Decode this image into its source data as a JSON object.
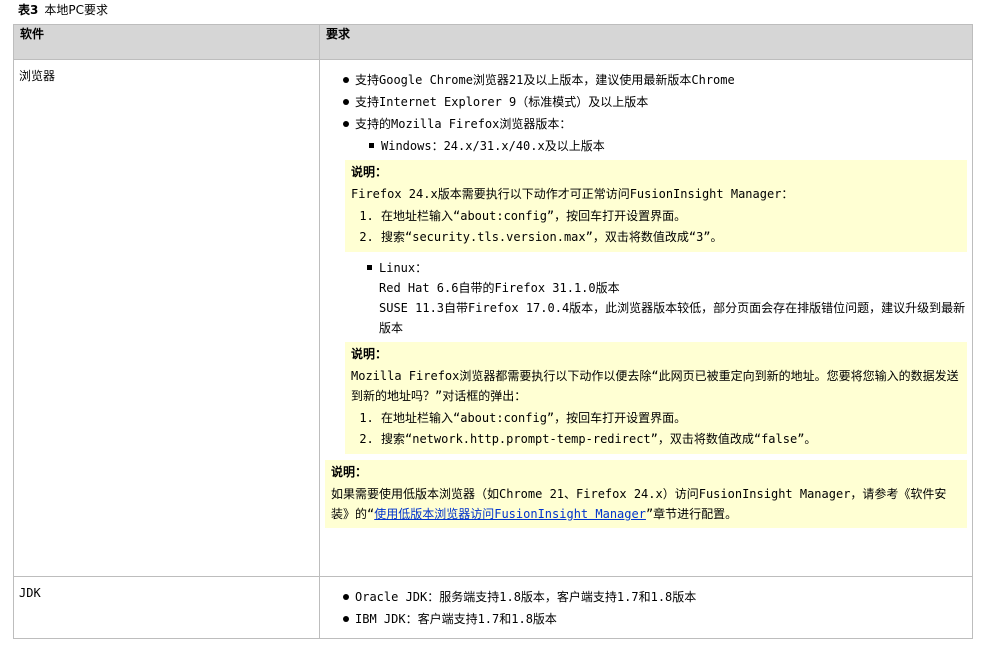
{
  "caption": {
    "number": "表3",
    "title": "本地PC要求"
  },
  "table": {
    "headers": [
      "软件",
      "要求"
    ],
    "browser": {
      "name": "浏览器",
      "items": [
        "支持Google Chrome浏览器21及以上版本，建议使用最新版本Chrome",
        "支持Internet Explorer 9（标准模式）及以上版本",
        "支持的Mozilla Firefox浏览器版本："
      ],
      "windows": {
        "label": "Windows：24.x/31.x/40.x及以上版本",
        "note": {
          "title": "说明：",
          "text": "Firefox 24.x版本需要执行以下动作才可正常访问FusionInsight Manager：",
          "steps": [
            "在地址栏输入“about:config”，按回车打开设置界面。",
            "搜索“security.tls.version.max”，双击将数值改成“3”。"
          ]
        }
      },
      "linux": {
        "label": "Linux：",
        "lines": [
          "Red Hat 6.6自带的Firefox 31.1.0版本",
          "SUSE 11.3自带Firefox 17.0.4版本，此浏览器版本较低，部分页面会存在排版错位问题，建议升级到最新版本"
        ],
        "note": {
          "title": "说明：",
          "text": "Mozilla Firefox浏览器都需要执行以下动作以便去除“此网页已被重定向到新的地址。您要将您输入的数据发送到新的地址吗？”对话框的弹出：",
          "steps": [
            "在地址栏输入“about:config”，按回车打开设置界面。",
            "搜索“network.http.prompt-temp-redirect”，双击将数值改成“false”。"
          ]
        }
      },
      "outer_note": {
        "title": "说明：",
        "text_before": "如果需要使用低版本浏览器（如Chrome 21、Firefox 24.x）访问FusionInsight Manager，请参考《软件安装》的“",
        "link": "使用低版本浏览器访问FusionInsight Manager",
        "text_after": "”章节进行配置。"
      }
    },
    "jdk": {
      "name": "JDK",
      "items": [
        "Oracle JDK：服务端支持1.8版本，客户端支持1.7和1.8版本",
        "IBM JDK：客户端支持1.7和1.8版本"
      ]
    }
  },
  "colors": {
    "header_bg": "#d6d6d6",
    "note_bg": "#ffffd3",
    "link": "#0033cc",
    "border": "#bdbdbd"
  }
}
